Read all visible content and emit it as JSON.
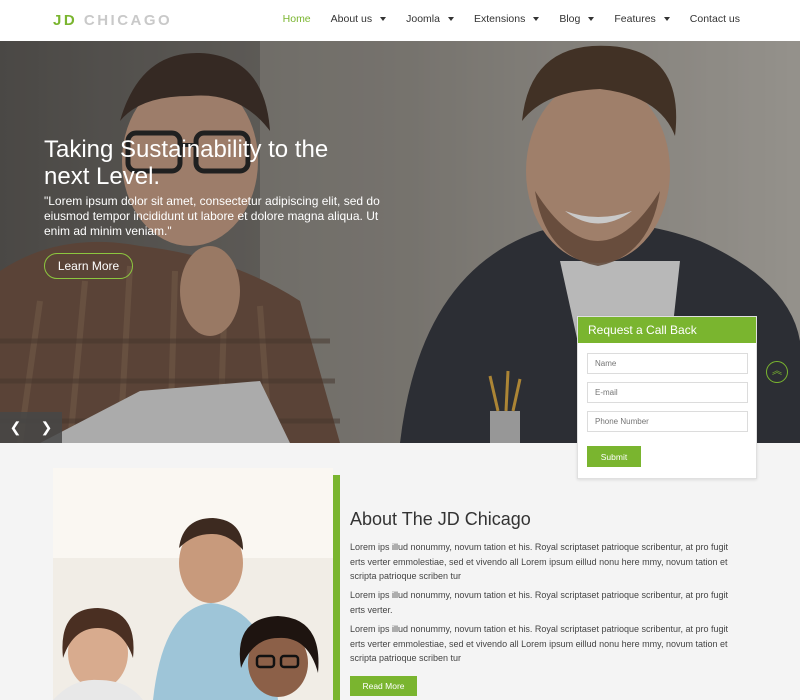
{
  "header": {
    "logo_jd": "JD",
    "logo_city": "CHICAGO",
    "nav": [
      {
        "label": "Home",
        "dropdown": false
      },
      {
        "label": "About us",
        "dropdown": true
      },
      {
        "label": "Joomla",
        "dropdown": true
      },
      {
        "label": "Extensions",
        "dropdown": true
      },
      {
        "label": "Blog",
        "dropdown": true
      },
      {
        "label": "Features",
        "dropdown": true
      },
      {
        "label": "Contact us",
        "dropdown": false
      }
    ]
  },
  "hero": {
    "title": "Taking Sustainability to the next Level.",
    "text": "\"Lorem ipsum dolor sit amet, consectetur adipiscing elit, sed do eiusmod tempor incididunt ut labore et dolore magna aliqua. Ut enim ad minim veniam.\"",
    "button": "Learn More",
    "prev_icon": "chevron-left-icon",
    "next_icon": "chevron-right-icon",
    "prev_glyph": "❮",
    "next_glyph": "❯",
    "scroll_glyph": "︽"
  },
  "callback": {
    "title": "Request a Call Back",
    "name_placeholder": "Name",
    "email_placeholder": "E-mail",
    "phone_placeholder": "Phone Number",
    "submit": "Submit"
  },
  "about": {
    "title": "About The JD Chicago",
    "paragraphs": [
      "Lorem ips illud nonummy, novum tation et his. Royal scriptaset patrioque scribentur, at pro fugit erts verter emmolestiae, sed et vivendo all Lorem ipsum eillud nonu here mmy, novum tation et scripta patrioque scriben tur",
      "Lorem ips illud nonummy, novum tation et his. Royal scriptaset patrioque scribentur, at pro fugit erts verter.",
      "Lorem ips illud nonummy, novum tation et his. Royal scriptaset patrioque scribentur, at pro fugit erts verter emmolestiae, sed et vivendo all Lorem ipsum eillud nonu here mmy, novum tation et scripta patrioque scriben tur"
    ],
    "button": "Read More"
  },
  "colors": {
    "accent": "#7ab52f",
    "header_bg": "#ffffff",
    "page_bg": "#f4f4f4"
  }
}
